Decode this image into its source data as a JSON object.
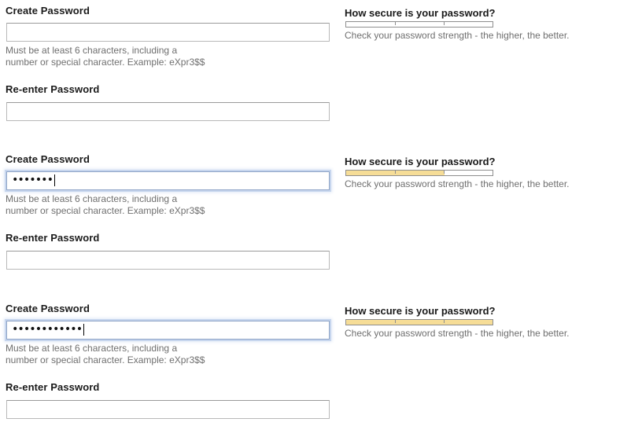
{
  "panels": [
    {
      "create_label": "Create Password",
      "create_value": "",
      "focused": false,
      "hint_line1": "Must be at least 6 characters, including a",
      "hint_line2": "number or special character. Example: eXpr3$$",
      "reenter_label": "Re-enter Password",
      "reenter_value": "",
      "strength_title": "How secure is your password?",
      "strength_level": 0,
      "strength_hint": "Check your password strength - the higher, the better."
    },
    {
      "create_label": "Create Password",
      "create_value": "•••••••",
      "focused": true,
      "hint_line1": "Must be at least 6 characters, including a",
      "hint_line2": "number or special character. Example: eXpr3$$",
      "reenter_label": "Re-enter Password",
      "reenter_value": "",
      "strength_title": "How secure is your password?",
      "strength_level": 0.67,
      "strength_hint": "Check your password strength - the higher, the better."
    },
    {
      "create_label": "Create Password",
      "create_value": "••••••••••••",
      "focused": true,
      "hint_line1": "Must be at least 6 characters, including a",
      "hint_line2": "number or special character. Example: eXpr3$$",
      "reenter_label": "Re-enter Password",
      "reenter_value": "",
      "strength_title": "How secure is your password?",
      "strength_level": 1.0,
      "strength_hint": "Check your password strength - the higher, the better."
    }
  ],
  "colors": {
    "meter_fill": "#f6dd97",
    "focus_ring": "#c7d6ee"
  }
}
